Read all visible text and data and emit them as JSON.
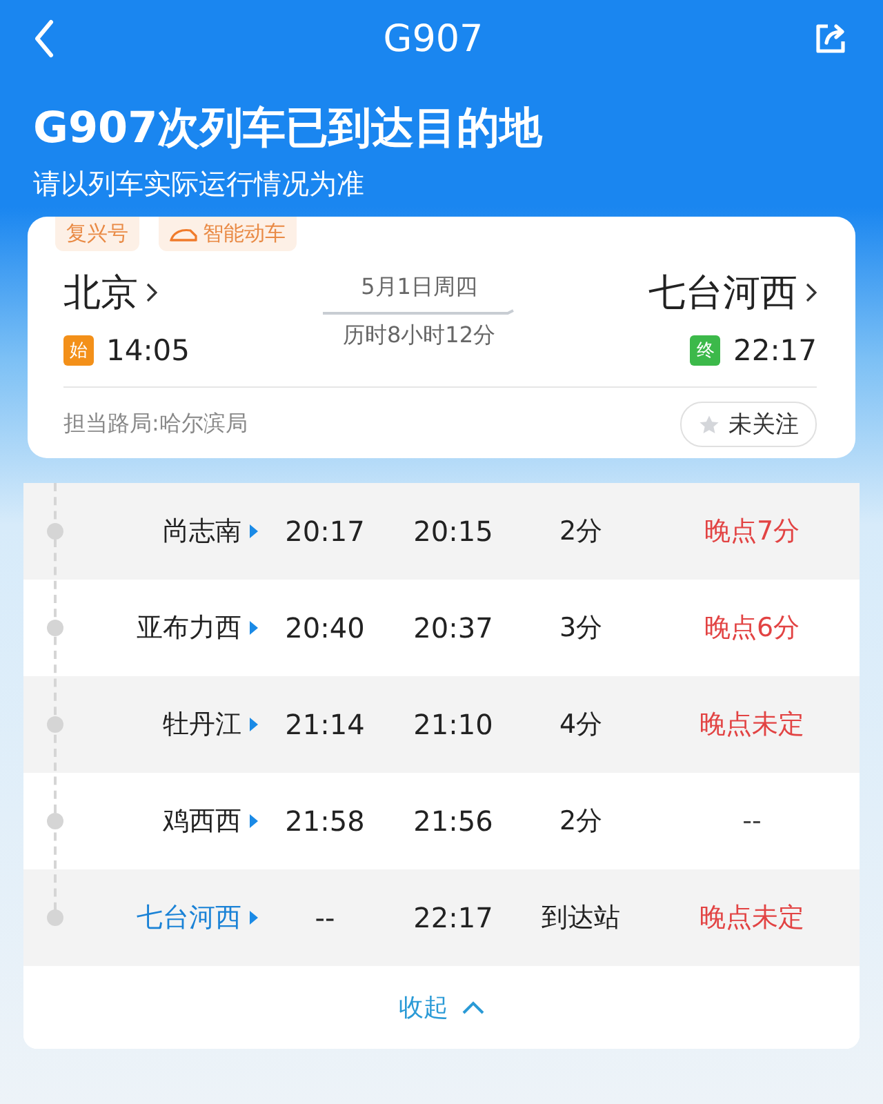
{
  "nav": {
    "title": "G907"
  },
  "status": {
    "headline": "G907次列车已到达目的地",
    "note": "请以列车实际运行情况为准"
  },
  "train_card": {
    "tags": [
      {
        "label": "复兴号",
        "kind": "plain"
      },
      {
        "label": "智能动车",
        "kind": "smart"
      }
    ],
    "departure": {
      "station": "北京",
      "badge": "始",
      "time": "14:05"
    },
    "date": "5月1日周四",
    "duration": "历时8小时12分",
    "arrival": {
      "station": "七台河西",
      "badge": "终",
      "time": "22:17"
    },
    "bureau": "担当路局:哈尔滨局",
    "follow_button": {
      "label": "未关注",
      "followed": false
    }
  },
  "stops": [
    {
      "station": "尚志南",
      "arrive": "20:17",
      "depart": "20:15",
      "stay": "2分",
      "delay": "晚点7分",
      "late": true,
      "selected": false
    },
    {
      "station": "亚布力西",
      "arrive": "20:40",
      "depart": "20:37",
      "stay": "3分",
      "delay": "晚点6分",
      "late": true,
      "selected": false
    },
    {
      "station": "牡丹江",
      "arrive": "21:14",
      "depart": "21:10",
      "stay": "4分",
      "delay": "晚点未定",
      "late": true,
      "selected": false
    },
    {
      "station": "鸡西西",
      "arrive": "21:58",
      "depart": "21:56",
      "stay": "2分",
      "delay": "--",
      "late": false,
      "selected": false
    },
    {
      "station": "七台河西",
      "arrive": "--",
      "depart": "22:17",
      "stay": "到达站",
      "delay": "晚点未定",
      "late": true,
      "selected": true
    }
  ],
  "collapse_button": {
    "label": "收起"
  }
}
